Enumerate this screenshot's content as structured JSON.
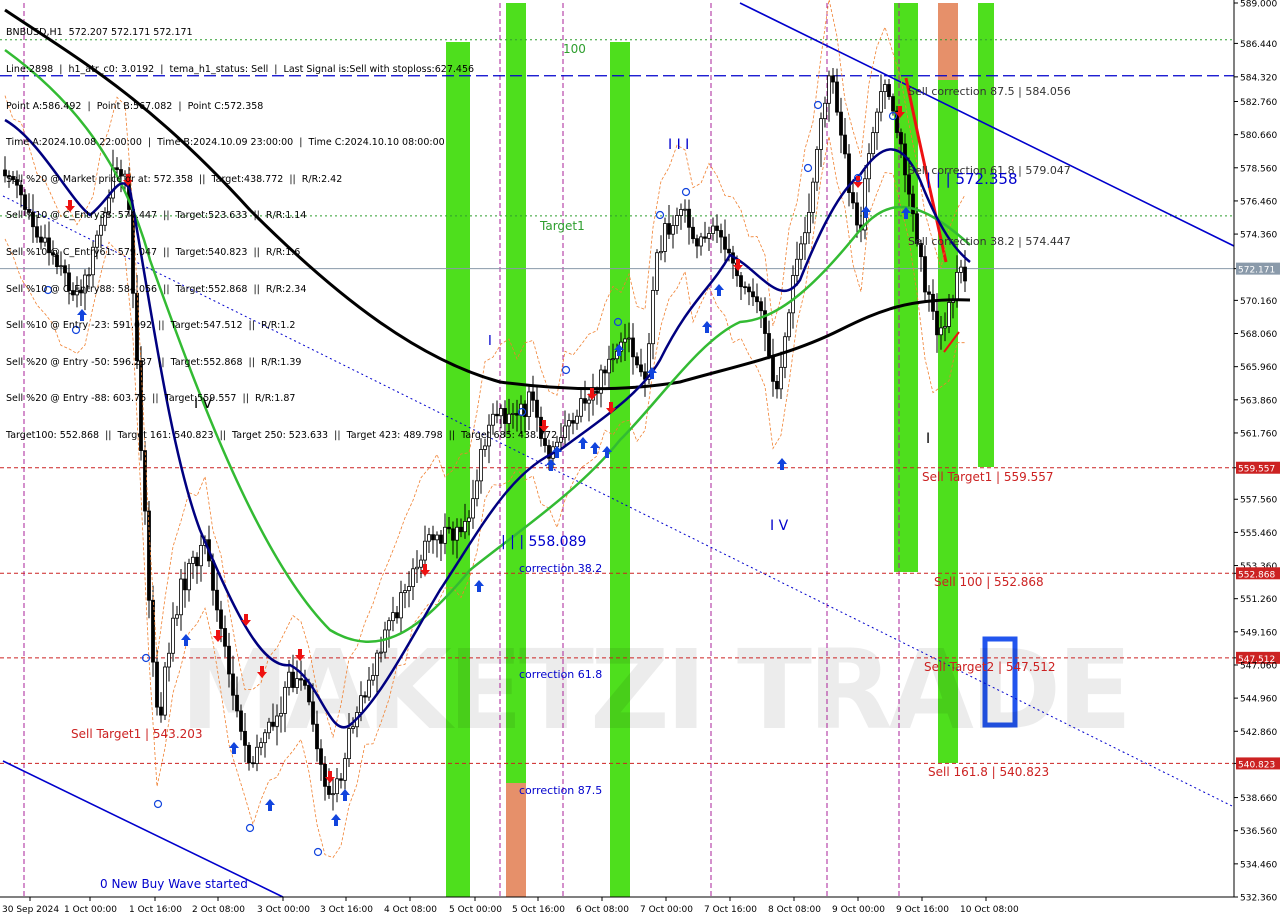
{
  "chart_data": {
    "type": "candlestick",
    "symbol_header": "BNBUSD,H1  572.207 572.171 572.171",
    "info_lines": [
      "Line:2898  |  h1_atr_c0: 3.0192  |  tema_h1_status: Sell  |  Last Signal is:Sell with stoploss:627.456",
      "Point A:586.492  |  Point B:567.082  |  Point C:572.358",
      "Time A:2024.10.08 22:00:00  |  Time B:2024.10.09 23:00:00  |  Time C:2024.10.10 08:00:00",
      "Sell %20 @ Market price or at: 572.358  ||  Target:438.772  ||  R/R:2.42",
      "Sell %10 @ C_Entry38: 574.447  ||  Target:523.633  ||  R/R:1.14",
      "Sell %10 @ C_Entry61: 579.047  ||  Target:540.823  ||  R/R:1.6",
      "Sell %10 @ C_Entry88: 584.056  ||  Target:552.868  ||  R/R:2.34",
      "Sell %10 @ Entry -23: 591.092  ||  Target:547.512  ||  R/R:1.2",
      "Sell %20 @ Entry -50: 596.237  ||  Target:552.868  ||  R/R:1.39",
      "Sell %20 @ Entry -88: 603.76  ||  Target:559.557  ||  R/R:1.87",
      "Target100: 552.868  ||  Target 161: 540.823  ||  Target 250: 523.633  ||  Target 423: 489.798  ||  Target 685: 438.772"
    ],
    "y_axis": {
      "min": 532.36,
      "max": 589.0,
      "ticks": [
        "589.000",
        "586.440",
        "584.320",
        "582.760",
        "580.660",
        "578.560",
        "576.460",
        "574.360",
        "572.171",
        "570.160",
        "568.060",
        "565.960",
        "563.860",
        "561.760",
        "559.557",
        "557.560",
        "555.460",
        "553.360",
        "552.868",
        "551.260",
        "549.160",
        "547.512",
        "547.060",
        "544.960",
        "542.860",
        "540.823",
        "538.660",
        "536.560",
        "534.460",
        "532.360"
      ]
    },
    "x_axis": {
      "labels": [
        "30 Sep 2024",
        "1 Oct 00:00",
        "1 Oct 16:00",
        "2 Oct 08:00",
        "3 Oct 00:00",
        "3 Oct 16:00",
        "4 Oct 08:00",
        "5 Oct 00:00",
        "5 Oct 16:00",
        "6 Oct 08:00",
        "7 Oct 00:00",
        "7 Oct 16:00",
        "8 Oct 08:00",
        "9 Oct 00:00",
        "9 Oct 16:00",
        "10 Oct 08:00"
      ]
    },
    "price_levels": [
      {
        "value": 586.668,
        "label": "586.668",
        "color": "#2e9e2e",
        "style": "dotted"
      },
      {
        "value": 584.392,
        "label": "584.392",
        "color": "#0000cc",
        "style": "dashed"
      },
      {
        "value": 575.516,
        "label": "575.516",
        "color": "#2e9e2e",
        "style": "dotted"
      },
      {
        "value": 572.171,
        "label": "572.171",
        "color": "#8a9aaa",
        "style": "solid"
      },
      {
        "value": 559.557,
        "label": "559.557",
        "color": "#cc2222",
        "style": "dashed"
      },
      {
        "value": 552.868,
        "label": "552.868",
        "color": "#cc2222",
        "style": "dashed"
      },
      {
        "value": 547.512,
        "label": "547.512",
        "color": "#cc2222",
        "style": "dashed"
      },
      {
        "value": 540.823,
        "label": "540.823",
        "color": "#cc2222",
        "style": "dashed"
      }
    ],
    "annotations": [
      {
        "text": "Sell Target1 | 559.557",
        "color": "#cc2222"
      },
      {
        "text": "Sell 100 | 552.868",
        "color": "#cc2222"
      },
      {
        "text": "Sell Target2 | 547.512",
        "color": "#cc2222"
      },
      {
        "text": "Sell 161.8 | 540.823",
        "color": "#cc2222"
      },
      {
        "text": "Sell Target1 | 543.203",
        "color": "#cc2222"
      },
      {
        "text": "Sell correction 87.5 | 584.056",
        "color": "#333333"
      },
      {
        "text": "Sell correction 61.8 | 579.047",
        "color": "#333333"
      },
      {
        "text": "Sell correction 38.2 | 574.447",
        "color": "#333333"
      },
      {
        "text": "| | | 572.358",
        "color": "#0000cc"
      },
      {
        "text": "| | | 558.089",
        "color": "#0000cc"
      },
      {
        "text": "correction 38.2",
        "color": "#0000cc"
      },
      {
        "text": "correction 61.8",
        "color": "#0000cc"
      },
      {
        "text": "correction 87.5",
        "color": "#0000cc"
      },
      {
        "text": "Target1",
        "color": "#2e9e2e"
      },
      {
        "text": "100",
        "color": "#2e9e2e"
      },
      {
        "text": "I I I",
        "color": "#0000cc"
      },
      {
        "text": "I V",
        "color": "#000000"
      },
      {
        "text": "I",
        "color": "#0000cc"
      },
      {
        "text": "I V",
        "color": "#0000cc"
      },
      {
        "text": "I",
        "color": "#000000"
      },
      {
        "text": "0 New Buy Wave started",
        "color": "#0000cc"
      }
    ],
    "vertical_zones": [
      {
        "from": "5 Oct 00:00",
        "to": "5 Oct 06:00",
        "color": "#44dd11"
      },
      {
        "from": "5 Oct 15:00",
        "to": "5 Oct 20:00",
        "color": "#44dd11"
      },
      {
        "from": "6 Oct 17:00",
        "to": "6 Oct 22:00",
        "color": "#44dd11"
      },
      {
        "from": "9 Oct 16:00",
        "to": "9 Oct 22:00",
        "color": "#44dd11"
      },
      {
        "from": "10 Oct 03:00",
        "to": "10 Oct 08:00",
        "color": "#44dd11"
      },
      {
        "from": "10 Oct 13:00",
        "to": "10 Oct 17:00",
        "color": "#44dd11"
      }
    ],
    "colors": {
      "background": "#ffffff",
      "candle": "#000000",
      "ma_black": "#000000",
      "ma_navy": "#000080",
      "ma_green": "#33bb33",
      "zone_green": "#44dd11",
      "zone_orange": "#e6906a",
      "trend_blue": "#0000cc",
      "grid": "#c8c8c8",
      "red_text": "#cc2222"
    },
    "watermark": "MAKETZI TRADE",
    "grid": false,
    "legend": "none"
  }
}
